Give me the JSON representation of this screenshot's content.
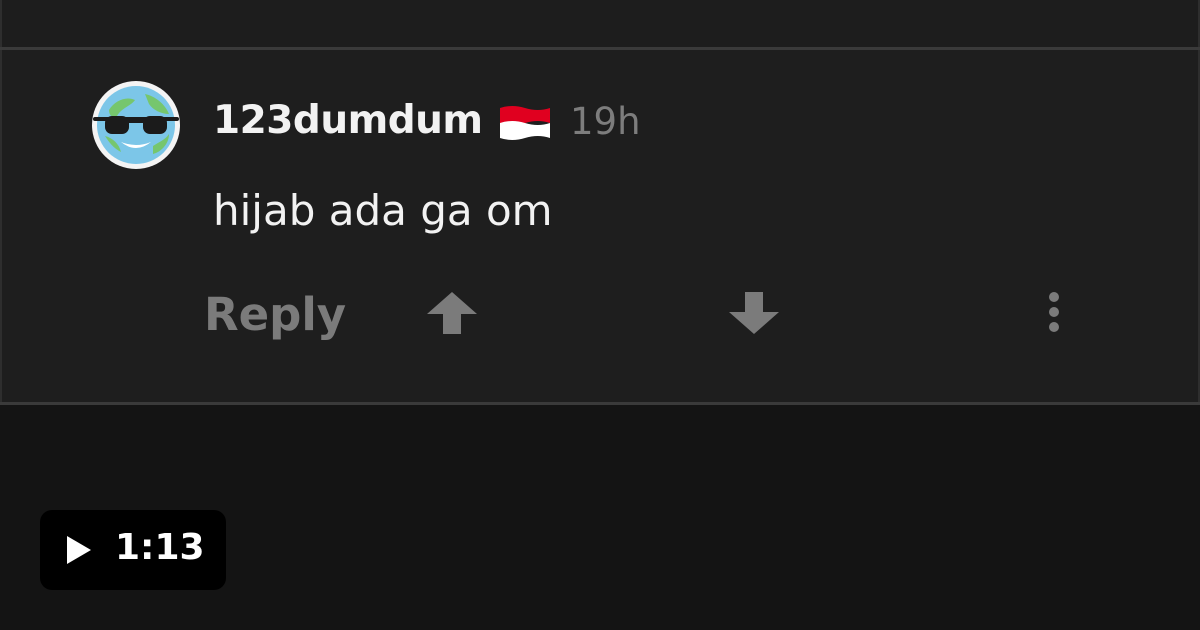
{
  "comment": {
    "author": {
      "username": "123dumdum",
      "flag_icon": "indonesia-flag-icon",
      "avatar_icon": "earth-sunglasses-avatar-icon"
    },
    "timestamp": "19h",
    "text": "hijab ada ga om",
    "actions": {
      "reply_label": "Reply",
      "upvote_icon": "arrow-up-icon",
      "downvote_icon": "arrow-down-icon",
      "more_icon": "more-vertical-icon"
    }
  },
  "video": {
    "duration": "1:13",
    "play_icon": "play-icon"
  },
  "colors": {
    "page_background": "#141414",
    "card_background": "#1e1e1e",
    "divider": "#3a3a3a",
    "primary_text": "#f2f2f2",
    "muted_text": "#7b7b7b",
    "flag_red": "#e0001f",
    "flag_white": "#ffffff",
    "badge_background": "#000000"
  }
}
